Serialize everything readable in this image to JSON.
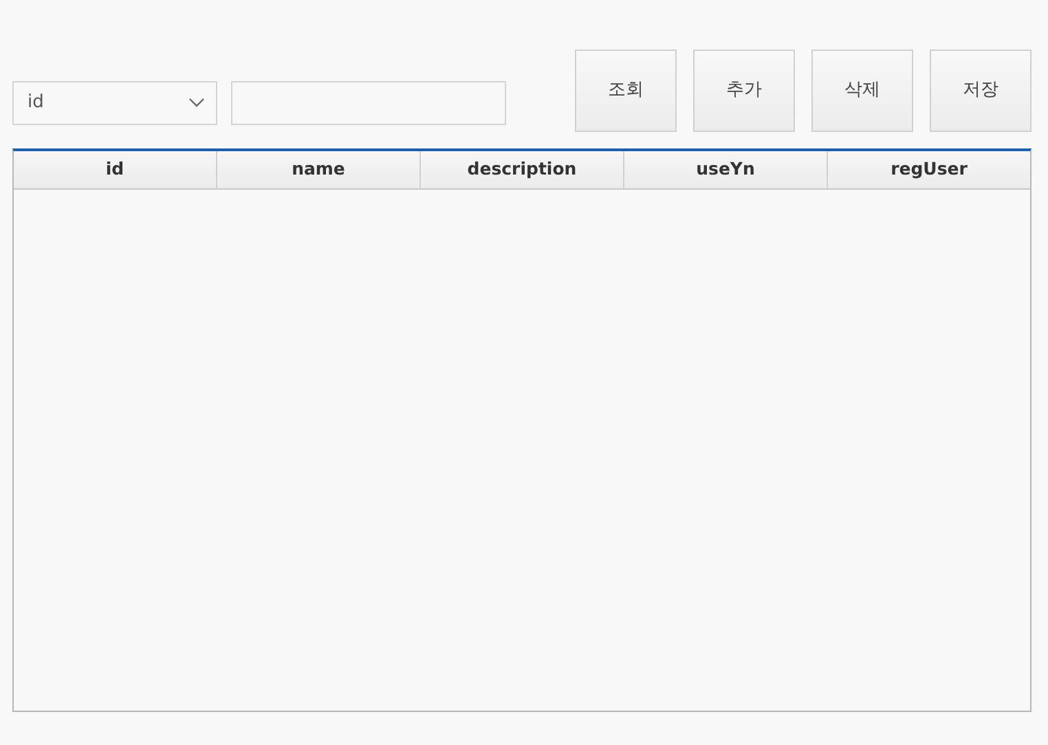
{
  "search": {
    "field_select": {
      "value": "id"
    }
  },
  "buttons": [
    "조회",
    "추가",
    "삭제",
    "저장"
  ],
  "table": {
    "columns": [
      "id",
      "name",
      "description",
      "useYn",
      "regUser"
    ]
  }
}
